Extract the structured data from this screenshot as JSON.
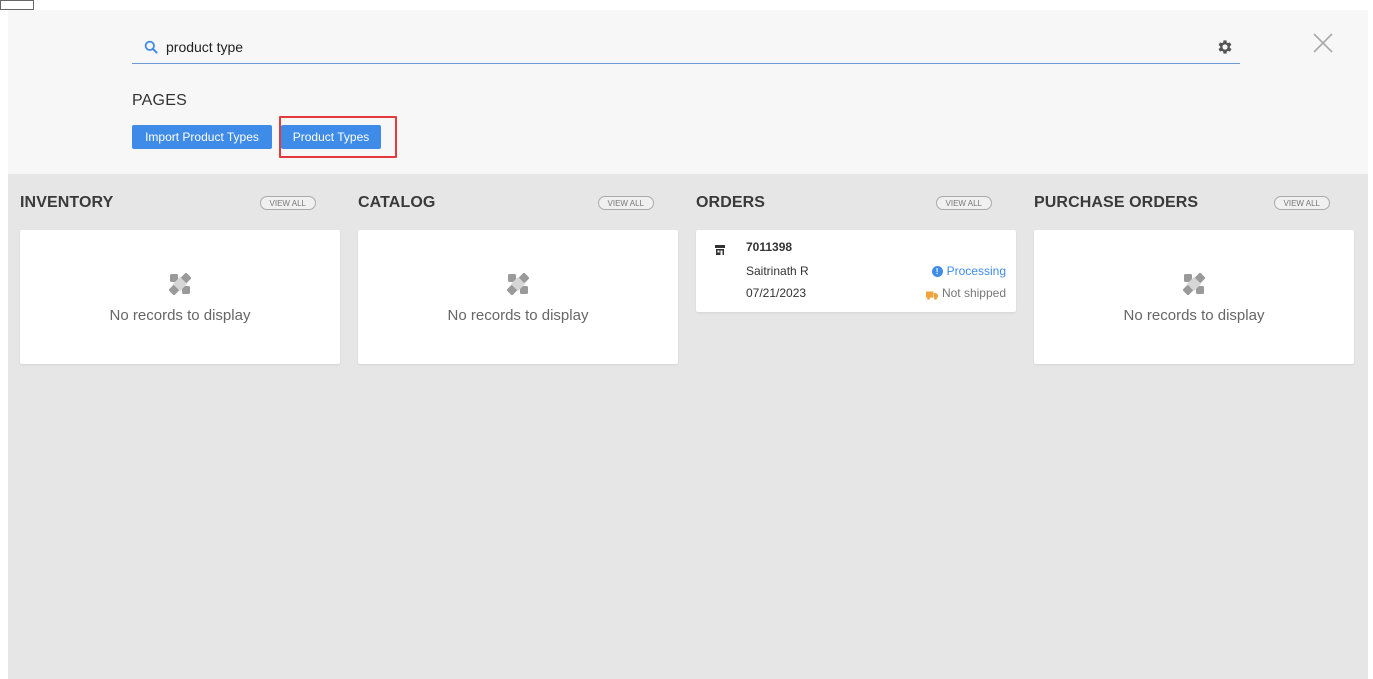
{
  "search": {
    "value": "product type",
    "placeholder": ""
  },
  "pages": {
    "title": "PAGES",
    "buttons": [
      {
        "label": "Import Product Types"
      },
      {
        "label": "Product Types"
      }
    ]
  },
  "sections": {
    "inventory": {
      "title": "INVENTORY",
      "view_all": "VIEW ALL",
      "empty": "No records to display"
    },
    "catalog": {
      "title": "CATALOG",
      "view_all": "VIEW ALL",
      "empty": "No records to display"
    },
    "orders": {
      "title": "ORDERS",
      "view_all": "VIEW ALL",
      "items": [
        {
          "id": "7011398",
          "customer": "Saitrinath R",
          "date": "07/21/2023",
          "status": "Processing",
          "shipping": "Not shipped"
        }
      ]
    },
    "purchase_orders": {
      "title": "PURCHASE ORDERS",
      "view_all": "VIEW ALL",
      "empty": "No records to display"
    }
  },
  "colors": {
    "accent": "#3e8be8",
    "highlight": "#e23b3b",
    "shipping_icon": "#f2a23a"
  },
  "icons": {
    "search": "search-icon",
    "settings": "gear-icon",
    "close": "close-icon",
    "empty": "no-records-icon",
    "store": "store-icon",
    "status": "info-icon",
    "shipping": "truck-icon"
  }
}
